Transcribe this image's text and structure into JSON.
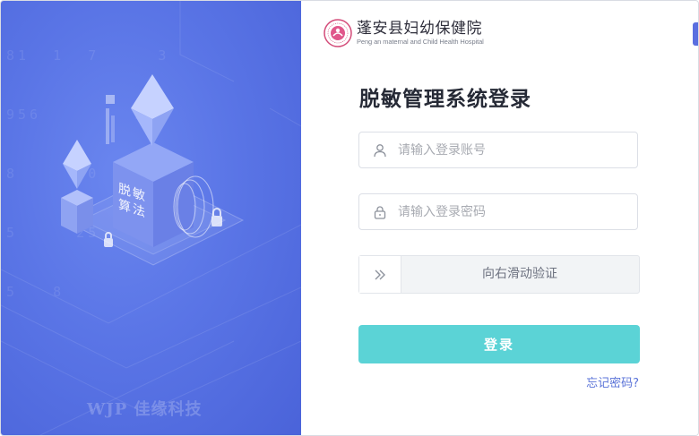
{
  "brand": {
    "name_cn": "蓬安县妇幼保健院",
    "name_en": "Peng an maternal and Child Health Hospital"
  },
  "login": {
    "title": "脱敏管理系统登录",
    "account_placeholder": "请输入登录账号",
    "password_placeholder": "请输入登录密码",
    "slider_text": "向右滑动验证",
    "submit_label": "登录",
    "forgot_label": "忘记密码?"
  },
  "illustration": {
    "cube_text": "脱敏算法",
    "watermark": "WJP 佳缘科技",
    "background_digits": [
      "81  1  7     3",
      "956        3",
      "8      0  82",
      "5     25   38",
      "5   8"
    ]
  },
  "colors": {
    "left_panel": "#5a75e6",
    "login_button": "#5bd3d6",
    "link": "#5a73d8",
    "accent_tab": "#5b6fe0"
  },
  "icons": {
    "account": "user-icon",
    "password": "lock-icon",
    "slider": "double-chevron-right-icon"
  }
}
